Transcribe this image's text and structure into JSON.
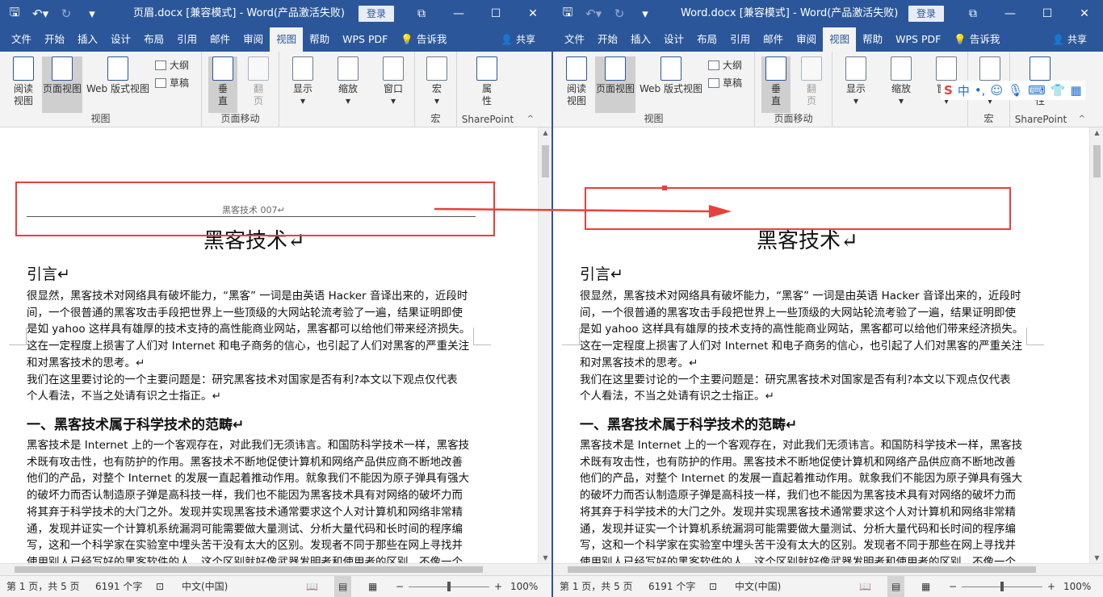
{
  "left": {
    "title": "页眉.docx [兼容模式] - Word(产品激活失败)",
    "login": "登录",
    "tabs": [
      "文件",
      "开始",
      "插入",
      "设计",
      "布局",
      "引用",
      "邮件",
      "审阅",
      "视图",
      "帮助",
      "WPS PDF",
      "告诉我"
    ],
    "share": "共享",
    "header_text": "黑客技术 007↵",
    "status": {
      "page": "第 1 页，共 5 页",
      "words": "6191 个字",
      "lang": "中文(中国)",
      "zoom": "100%"
    }
  },
  "right": {
    "title": "Word.docx [兼容模式] - Word(产品激活失败)",
    "login": "登录",
    "tabs": [
      "文件",
      "开始",
      "插入",
      "设计",
      "布局",
      "引用",
      "邮件",
      "审阅",
      "视图",
      "帮助",
      "WPS PDF",
      "告诉我"
    ],
    "share": "共享",
    "status": {
      "page": "第 1 页，共 5 页",
      "words": "6191 个字",
      "lang": "中文(中国)",
      "zoom": "100%"
    }
  },
  "ribbon": {
    "read_view": "阅读\n视图",
    "page_view": "页面视图",
    "web_view": "Web 版式视图",
    "outline": "大纲",
    "draft": "草稿",
    "vertical": "垂\n直",
    "flip": "翻\n页",
    "show": "显示",
    "zoom": "缩放",
    "window": "窗口",
    "macro": "宏",
    "properties": "属\n性",
    "group_view": "视图",
    "group_pagemove": "页面移动",
    "group_macro": "宏",
    "group_sharepoint": "SharePoint"
  },
  "doc": {
    "title": "黑客技术↵",
    "intro": "引言↵",
    "p1": [
      "很显然，黑客技术对网络具有破坏能力，“黑客” 一词是由英语 Hacker 音译出来的，近段时",
      "间，一个很普通的黑客攻击手段把世界上一些顶级的大网站轮流考验了一遍，结果证明即使",
      "是如 yahoo 这样具有雄厚的技术支持的高性能商业网站，黑客都可以给他们带来经济损失。",
      "这在一定程度上损害了人们对 Internet 和电子商务的信心，也引起了人们对黑客的严重关注",
      "和对黑客技术的思考。↵"
    ],
    "p2": [
      "我们在这里要讨论的一个主要问题是：研究黑客技术对国家是否有利?本文以下观点仅代表",
      "个人看法，不当之处请有识之士指正。↵"
    ],
    "section1": "一、黑客技术属于科学技术的范畴↵",
    "p3": [
      "黑客技术是 Internet 上的一个客观存在，对此我们无须讳言。和国防科学技术一样，黑客技",
      "术既有攻击性，也有防护的作用。黑客技术不断地促使计算机和网络产品供应商不断地改善",
      "他们的产品，对整个 Internet 的发展一直起着推动作用。就象我们不能因为原子弹具有强大",
      "的破坏力而否认制造原子弹是高科技一样，我们也不能因为黑客技术具有对网络的破坏力而",
      "将其弃于科学技术的大门之外。发现并实现黑客技术通常要求这个人对计算机和网络非常精",
      "通，发现并证实一个计算机系统漏洞可能需要做大量测试、分析大量代码和长时间的程序编",
      "写，这和一个科学家在实验室中埋头苦干没有太大的区别。发现者不同于那些在网上寻找并",
      "使用别人已经写好的黑客软件的人，这个区别就好像武器发明者和使用者的区别，不像一个"
    ]
  }
}
